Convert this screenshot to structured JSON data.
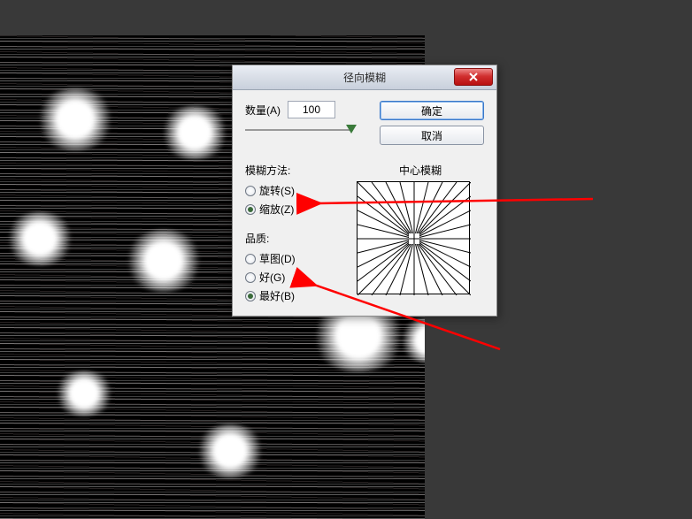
{
  "dialog": {
    "title": "径向模糊",
    "amount_label": "数量(A)",
    "amount_value": "100",
    "ok_label": "确定",
    "cancel_label": "取消",
    "method_group_label": "模糊方法:",
    "method_options": {
      "spin": "旋转(S)",
      "zoom": "缩放(Z)"
    },
    "method_selected": "zoom",
    "quality_group_label": "品质:",
    "quality_options": {
      "draft": "草图(D)",
      "good": "好(G)",
      "best": "最好(B)"
    },
    "quality_selected": "best",
    "preview_label": "中心模糊"
  }
}
